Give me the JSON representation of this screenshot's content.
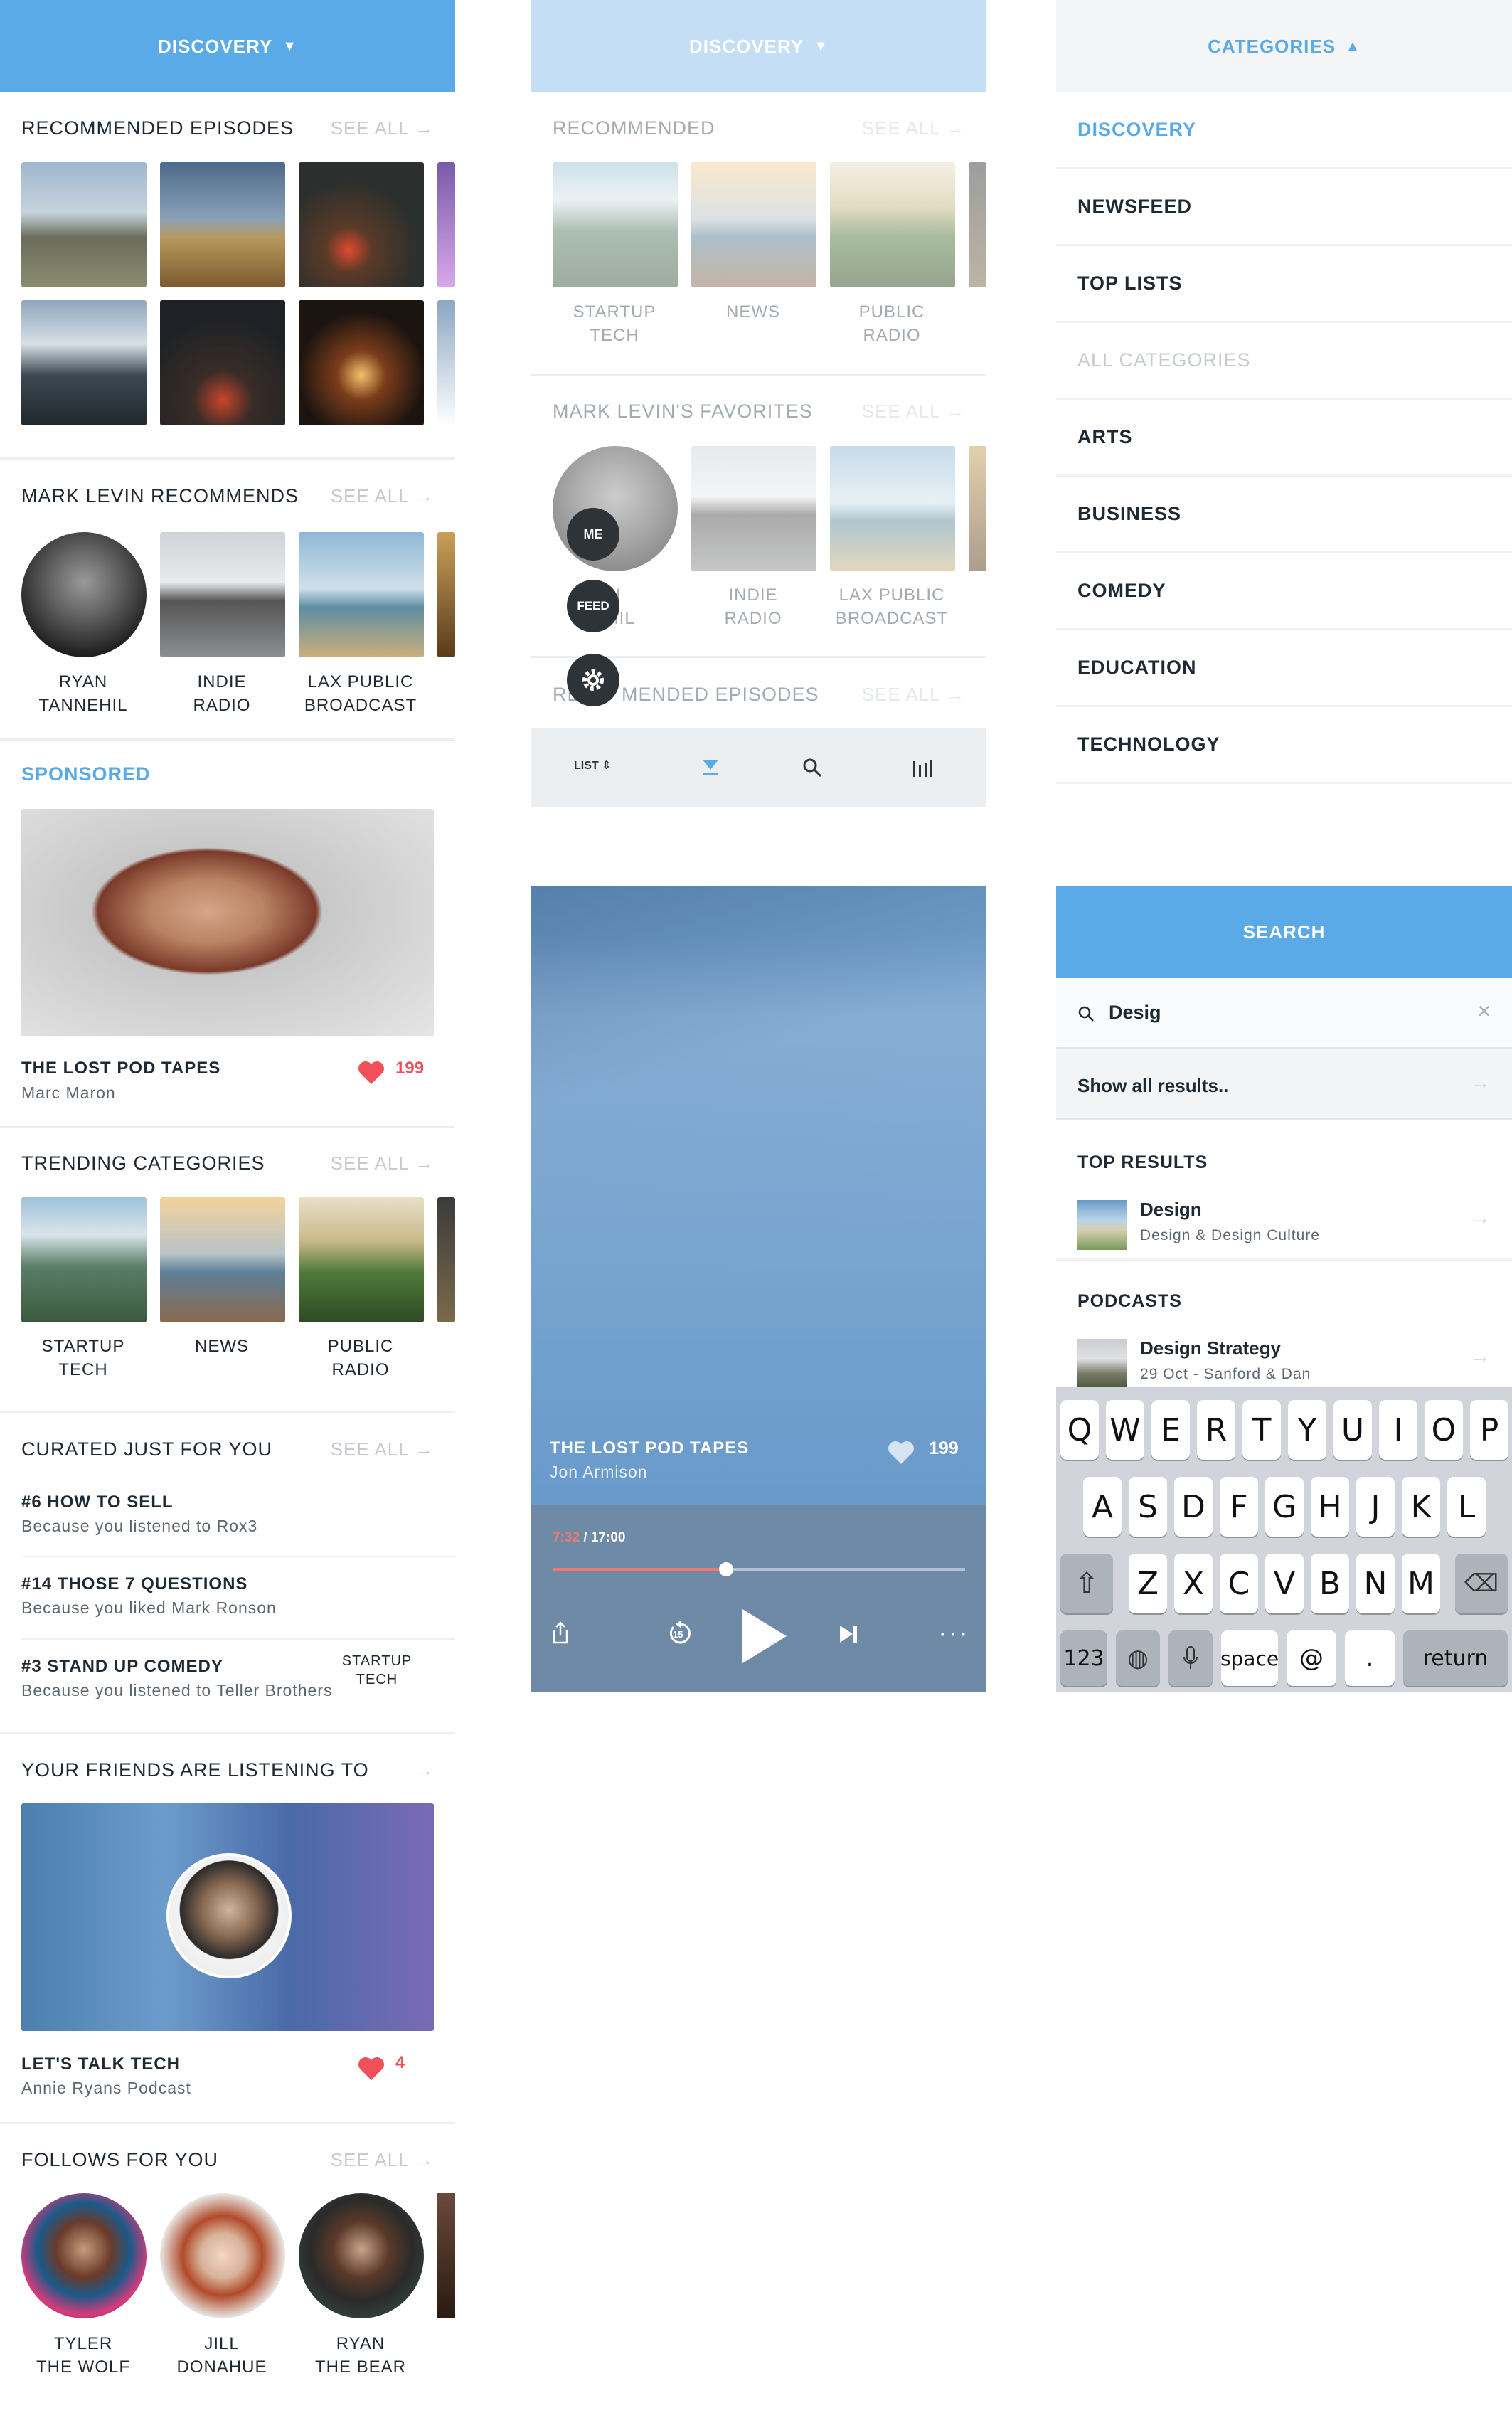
{
  "colors": {
    "accent": "#5aaae8",
    "heart": "#f0505a",
    "text": "#1f2933",
    "muted": "#c5cbd0"
  },
  "screen1": {
    "header": {
      "title": "DISCOVERY",
      "caret": "▼"
    },
    "recommended": {
      "title": "RECOMMENDED EPISODES",
      "see_all": "SEE ALL"
    },
    "mark": {
      "title": "MARK LEVIN RECOMMENDS",
      "see_all": "SEE ALL",
      "items": [
        {
          "label": "RYAN\nTANNEHIL"
        },
        {
          "label": "INDIE\nRADIO"
        },
        {
          "label": "LAX PUBLIC\nBROADCAST"
        }
      ]
    },
    "sponsored": {
      "title": "SPONSORED",
      "podcast": "THE LOST POD TAPES",
      "author": "Marc Maron",
      "likes": "199"
    },
    "trending": {
      "title": "TRENDING CATEGORIES",
      "see_all": "SEE ALL",
      "items": [
        {
          "label": "STARTUP\nTECH"
        },
        {
          "label": "NEWS"
        },
        {
          "label": "PUBLIC\nRADIO"
        }
      ]
    },
    "curated": {
      "title": "CURATED JUST FOR YOU",
      "see_all": "SEE ALL",
      "items": [
        {
          "title": "#6 HOW TO SELL",
          "sub": "Because you listened to Rox3"
        },
        {
          "title": "#14 THOSE 7 QUESTIONS",
          "sub": "Because you liked Mark Ronson"
        },
        {
          "title": "#3 STAND UP COMEDY",
          "sub": "Because you listened to Teller Brothers"
        }
      ],
      "overlay": "STARTUP\nTECH"
    },
    "friends": {
      "title": "YOUR FRIENDS ARE LISTENING TO",
      "podcast": "LET'S TALK TECH",
      "author": "Annie Ryans Podcast",
      "likes": "4"
    },
    "follows": {
      "title": "FOLLOWS FOR YOU",
      "see_all": "SEE ALL",
      "items": [
        {
          "label": "TYLER\nTHE WOLF"
        },
        {
          "label": "JILL\nDONAHUE"
        },
        {
          "label": "RYAN\nTHE BEAR"
        }
      ]
    }
  },
  "screen2": {
    "header": {
      "title": "DISCOVERY",
      "caret": "▼"
    },
    "recommended": {
      "title": "RECOMMENDED",
      "see_all": "SEE ALL",
      "items": [
        {
          "label": "STARTUP\nTECH"
        },
        {
          "label": "NEWS"
        },
        {
          "label": "PUBLIC\nRADIO"
        }
      ]
    },
    "favorites": {
      "title": "MARK LEVIN'S FAVORITES",
      "see_all": "SEE ALL",
      "items": [
        {
          "label": "N\nEHIL"
        },
        {
          "label": "INDIE\nRADIO"
        },
        {
          "label": "LAX PUBLIC\nBROADCAST"
        }
      ]
    },
    "episodes": {
      "title_a": "RE",
      "title_b": "MENDED EPISODES",
      "see_all": "SEE ALL"
    },
    "fab": {
      "me": "ME",
      "feed": "FEED"
    },
    "tabbar": {
      "list": "LIST"
    }
  },
  "player": {
    "podcast": "THE LOST POD TAPES",
    "author": "Jon Armison",
    "likes": "199",
    "elapsed": "7:32",
    "total": "/ 17:00",
    "progress": 0.42,
    "skip": "15"
  },
  "categories": {
    "header": {
      "title": "CATEGORIES",
      "caret": "▲"
    },
    "items": [
      {
        "label": "DISCOVERY",
        "state": "active"
      },
      {
        "label": "NEWSFEED"
      },
      {
        "label": "TOP LISTS"
      },
      {
        "label": "ALL CATEGORIES",
        "state": "disabled"
      },
      {
        "label": "ARTS"
      },
      {
        "label": "BUSINESS"
      },
      {
        "label": "COMEDY"
      },
      {
        "label": "EDUCATION"
      },
      {
        "label": "TECHNOLOGY"
      }
    ]
  },
  "search": {
    "header": "SEARCH",
    "query": "Desig",
    "show_all": "Show all results..",
    "top_results": {
      "title": "TOP RESULTS",
      "name": "Design",
      "sub": "Design & Design Culture"
    },
    "podcasts": {
      "title": "PODCASTS",
      "name": "Design Strategy",
      "sub": "29 Oct - Sanford & Dan"
    },
    "keyboard": {
      "row1": [
        "Q",
        "W",
        "E",
        "R",
        "T",
        "Y",
        "U",
        "I",
        "O",
        "P"
      ],
      "row2": [
        "A",
        "S",
        "D",
        "F",
        "G",
        "H",
        "J",
        "K",
        "L"
      ],
      "row3": [
        "Z",
        "X",
        "C",
        "V",
        "B",
        "N",
        "M"
      ],
      "num": "123",
      "space": "space",
      "at": "@",
      "dot": ".",
      "ret": "return"
    }
  }
}
